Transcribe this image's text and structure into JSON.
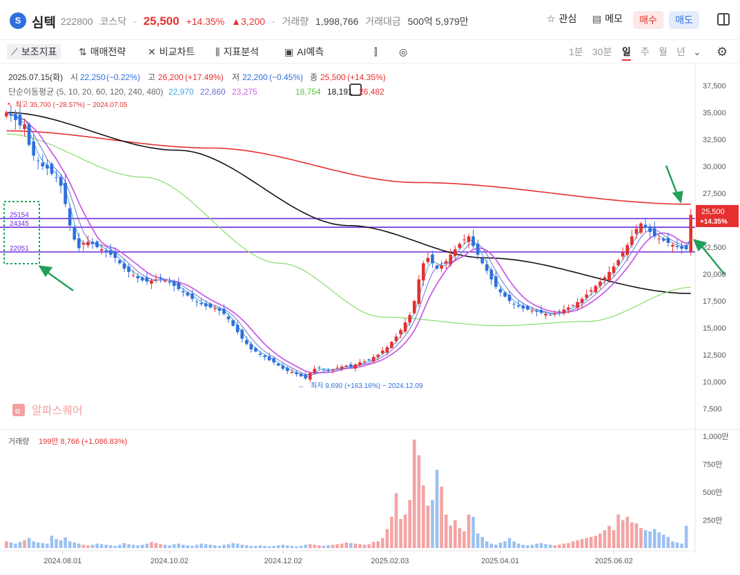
{
  "header": {
    "logo_letter": "S",
    "name": "심텍",
    "code": "222800",
    "market": "코스닥",
    "sep": "·",
    "price": "25,500",
    "change_pct": "+14.35%",
    "change_amt": "▲3,200",
    "volume_label": "거래량",
    "volume": "1,998,766",
    "amount_label": "거래대금",
    "amount": "500억 5,979만",
    "watch_label": "관심",
    "memo_label": "메모",
    "buy_label": "매수",
    "sell_label": "매도"
  },
  "toolbar": {
    "items": [
      "보조지표",
      "매매전략",
      "비교차트",
      "지표분석",
      "AI예측"
    ],
    "periods": [
      "1분",
      "30분",
      "일",
      "주",
      "월",
      "년"
    ],
    "selected_period": "일"
  },
  "colors": {
    "up": "#e5302f",
    "down": "#2f6fdc",
    "ma5": "#3fa6e0",
    "ma10": "#6e6cd6",
    "ma20": "#c85ee6",
    "ma120": "#86dc6a",
    "ma240": "#111111",
    "ma480": "#e5302f",
    "support": "#6a2ad8",
    "volume_up": "#f4a3a3",
    "volume_down": "#9cc1f2"
  },
  "chart_data": [
    {
      "type": "candlestick",
      "title": "",
      "info_line": {
        "date": "2025.07.15(화)",
        "open_label": "시",
        "open": "22,250",
        "open_pct": "(−0.22%)",
        "high_label": "고",
        "high": "26,200",
        "high_pct": "(+17.49%)",
        "low_label": "저",
        "low": "22,200",
        "low_pct": "(−0.45%)",
        "close_label": "종",
        "close": "25,500",
        "close_pct": "(+14.35%)"
      },
      "ma_line": {
        "label": "단순이동평균 (5, 10, 20, 60, 120, 240, 480)",
        "values": [
          "22,970",
          "22,860",
          "23,275",
          "18,754",
          "18,191",
          "26,482"
        ]
      },
      "x_ticks": [
        "2024.08.01",
        "2024.10.02",
        "2024.12.02",
        "2025.02.03",
        "2025.04.01",
        "2025.06.02"
      ],
      "y_ticks": [
        "37,500",
        "35,000",
        "32,500",
        "30,000",
        "27,500",
        "25,000",
        "22,500",
        "20,000",
        "17,500",
        "15,000",
        "12,500",
        "10,000",
        "7,500"
      ],
      "ylim": [
        7500,
        37500
      ],
      "max_annotation": "최고 35,700 (−28.57%) − 2024.07.05",
      "min_annotation": "최저 9,690 (+163.16%) − 2024.12.09",
      "last_price_tag": "25,500",
      "last_pct_tag": "+14.35%",
      "horizontal_lines": [
        25154,
        24345,
        22051
      ],
      "horizontal_line_labels": [
        "25154",
        "24345",
        "22051"
      ],
      "watermark": "알파스퀘어",
      "close_series": [
        35000,
        34700,
        34300,
        33800,
        33900,
        32000,
        31000,
        30500,
        30000,
        29800,
        29300,
        29000,
        28200,
        26500,
        24500,
        23200,
        22400,
        22900,
        23000,
        22800,
        22500,
        22300,
        22100,
        21800,
        21500,
        21000,
        20500,
        20200,
        19900,
        19600,
        19400,
        19300,
        19400,
        19500,
        19600,
        19400,
        19200,
        18900,
        18600,
        18300,
        18000,
        17700,
        17400,
        17200,
        17000,
        16900,
        16800,
        16600,
        16300,
        15800,
        15200,
        14600,
        14000,
        13500,
        13000,
        12800,
        12500,
        12300,
        12000,
        11800,
        11500,
        11200,
        11000,
        10900,
        10700,
        10500,
        10300,
        10800,
        11200,
        11300,
        11100,
        11000,
        11100,
        11300,
        11400,
        11500,
        11400,
        11600,
        11800,
        11900,
        12000,
        12300,
        12500,
        12900,
        13200,
        13700,
        14200,
        14800,
        15500,
        16200,
        17500,
        19500,
        21000,
        21500,
        21000,
        20500,
        20800,
        21200,
        21800,
        22300,
        22800,
        23200,
        23500,
        22600,
        21800,
        21000,
        20300,
        19500,
        18800,
        18300,
        17900,
        17500,
        17200,
        17000,
        16800,
        16700,
        16600,
        16500,
        16400,
        16300,
        16200,
        16300,
        16500,
        16700,
        16900,
        17100,
        17400,
        17700,
        18100,
        18500,
        18900,
        19300,
        19700,
        20200,
        20700,
        21300,
        22000,
        22700,
        23500,
        24200,
        24700,
        24300,
        23900,
        23500,
        23300,
        23100,
        22900,
        22700,
        22500,
        22350,
        22300,
        25500
      ],
      "y_label_volume": "거래량",
      "volume_info": "199만 8,766 (+1,086.83%)",
      "volume_ticks": [
        "1,000만",
        "750만",
        "500만",
        "250만"
      ],
      "volume_ylim": [
        0,
        10000000
      ],
      "volume_series": [
        60,
        50,
        40,
        55,
        70,
        90,
        60,
        50,
        45,
        40,
        110,
        80,
        70,
        95,
        60,
        50,
        40,
        30,
        25,
        30,
        40,
        35,
        30,
        25,
        20,
        30,
        45,
        35,
        30,
        25,
        30,
        40,
        55,
        45,
        35,
        30,
        25,
        35,
        40,
        30,
        25,
        20,
        30,
        40,
        35,
        30,
        25,
        20,
        30,
        35,
        45,
        40,
        30,
        25,
        20,
        20,
        25,
        20,
        15,
        20,
        25,
        30,
        25,
        20,
        15,
        20,
        30,
        35,
        30,
        25,
        20,
        25,
        30,
        35,
        40,
        50,
        45,
        40,
        35,
        30,
        35,
        55,
        60,
        90,
        170,
        280,
        490,
        260,
        300,
        430,
        970,
        830,
        560,
        380,
        430,
        700,
        550,
        300,
        200,
        250,
        180,
        150,
        300,
        280,
        130,
        100,
        60,
        40,
        30,
        50,
        60,
        90,
        60,
        40,
        30,
        25,
        30,
        40,
        45,
        35,
        30,
        25,
        30,
        40,
        45,
        60,
        70,
        80,
        90,
        100,
        110,
        130,
        160,
        200,
        160,
        300,
        250,
        280,
        230,
        220,
        180,
        160,
        150,
        170,
        140,
        120,
        100,
        60,
        50,
        40,
        200
      ]
    }
  ]
}
